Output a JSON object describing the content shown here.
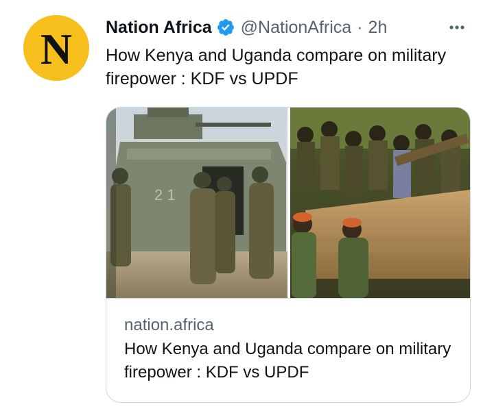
{
  "tweet": {
    "avatar_letter": "N",
    "display_name": "Nation Africa",
    "verified_icon": "verified-badge-icon",
    "handle": "@NationAfrica",
    "separator": "·",
    "time": "2h",
    "more_icon": "more-horizontal-icon",
    "text": "How Kenya and Uganda compare on military firepower : KDF vs UPDF"
  },
  "card": {
    "image_icon": "military-photo-image",
    "domain": "nation.africa",
    "title": "How Kenya and Uganda compare on military firepower : KDF vs UPDF"
  },
  "colors": {
    "avatar_bg": "#f6bf1c",
    "verified_blue": "#1d9bf0",
    "secondary_text": "#536471",
    "border": "#cfd9de"
  }
}
